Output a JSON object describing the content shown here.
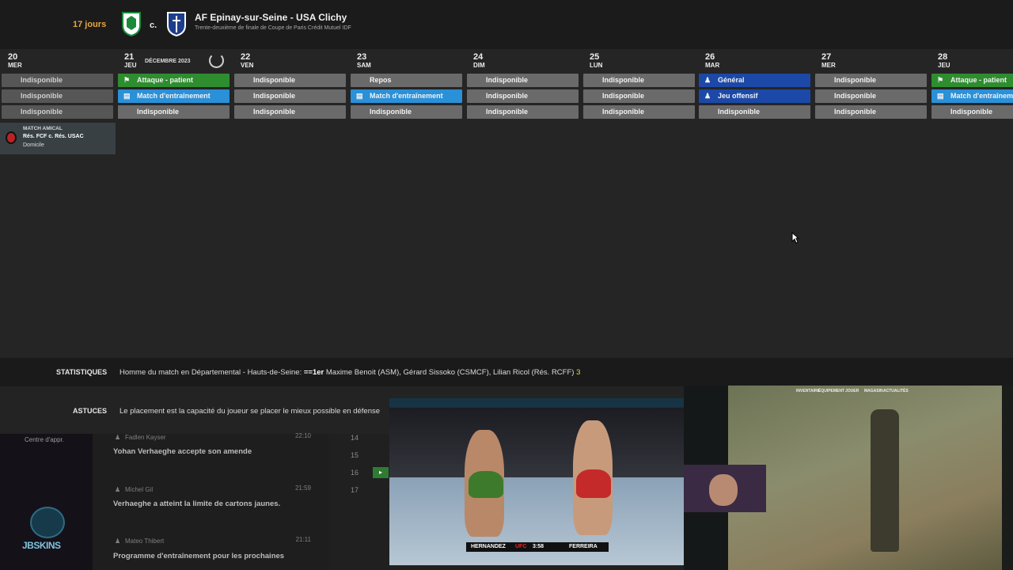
{
  "header": {
    "days_left": "17 jours",
    "vs": "c.",
    "match_title": "AF Epinay-sur-Seine - USA Clichy",
    "match_subtitle": "Trente-deuxième de finale de Coupe de Paris Crédit Mutuel IDF"
  },
  "calendar": {
    "month_label": "DÉCEMBRE 2023",
    "days": [
      {
        "num": "20",
        "name": "MER",
        "slots": [
          {
            "label": "Indisponible",
            "style": "dim"
          },
          {
            "label": "Indisponible",
            "style": "dim"
          },
          {
            "label": "Indisponible",
            "style": "dim"
          }
        ]
      },
      {
        "num": "21",
        "name": "JEU",
        "slots": [
          {
            "label": "Attaque - patient",
            "style": "green",
            "icon": "runner"
          },
          {
            "label": "Match d'entraînement",
            "style": "sky",
            "icon": "board"
          },
          {
            "label": "Indisponible",
            "style": "grey"
          }
        ]
      },
      {
        "num": "22",
        "name": "VEN",
        "slots": [
          {
            "label": "Indisponible",
            "style": "grey"
          },
          {
            "label": "Indisponible",
            "style": "grey"
          },
          {
            "label": "Indisponible",
            "style": "grey"
          }
        ]
      },
      {
        "num": "23",
        "name": "SAM",
        "slots": [
          {
            "label": "Repos",
            "style": "grey"
          },
          {
            "label": "Match d'entraînement",
            "style": "sky",
            "icon": "board"
          },
          {
            "label": "Indisponible",
            "style": "grey"
          }
        ]
      },
      {
        "num": "24",
        "name": "DIM",
        "slots": [
          {
            "label": "Indisponible",
            "style": "grey"
          },
          {
            "label": "Indisponible",
            "style": "grey"
          },
          {
            "label": "Indisponible",
            "style": "grey"
          }
        ]
      },
      {
        "num": "25",
        "name": "LUN",
        "slots": [
          {
            "label": "Indisponible",
            "style": "grey"
          },
          {
            "label": "Indisponible",
            "style": "grey"
          },
          {
            "label": "Indisponible",
            "style": "grey"
          }
        ]
      },
      {
        "num": "26",
        "name": "MAR",
        "slots": [
          {
            "label": "Général",
            "style": "navy",
            "icon": "person"
          },
          {
            "label": "Jeu offensif",
            "style": "navy",
            "icon": "person"
          },
          {
            "label": "Indisponible",
            "style": "grey"
          }
        ]
      },
      {
        "num": "27",
        "name": "MER",
        "slots": [
          {
            "label": "Indisponible",
            "style": "grey"
          },
          {
            "label": "Indisponible",
            "style": "grey"
          },
          {
            "label": "Indisponible",
            "style": "grey"
          }
        ]
      },
      {
        "num": "28",
        "name": "JEU",
        "slots": [
          {
            "label": "Attaque - patient",
            "style": "green",
            "icon": "runner"
          },
          {
            "label": "Match d'entraînement",
            "style": "sky",
            "icon": "board"
          },
          {
            "label": "Indisponible",
            "style": "grey"
          }
        ]
      }
    ]
  },
  "event": {
    "type": "MATCH AMICAL",
    "name": "Rés. FCF c. Rés. USAC",
    "location": "Domicile"
  },
  "stats": {
    "label": "STATISTIQUES",
    "prefix": "Homme du match en Départemental - Hauts-de-Seine: ",
    "rank": "==1er",
    "players": " Maxime Benoit (ASM), Gérard Sissoko (CSMCF), Lilian Ricol (Rés. RCFF) ",
    "count": "3"
  },
  "tips": {
    "label": "ASTUCES",
    "text": "Le placement est la capacité du joueur se placer le mieux possible en défense"
  },
  "sidebar": {
    "item": "Centre d'appr.",
    "logo_text": "JBSKINS"
  },
  "news": [
    {
      "author": "Fadlen Kayser",
      "time": "22:10",
      "headline": "Yohan Verhaeghe accepte son amende"
    },
    {
      "author": "Michel Gil",
      "time": "21:59",
      "headline": "Verhaeghe a atteint la limite de cartons jaunes."
    },
    {
      "author": "Mateo Thibert",
      "time": "21:11",
      "headline": "Programme d'entraînement pour les prochaines"
    }
  ],
  "rows": [
    "14",
    "15",
    "16",
    "17"
  ],
  "video": {
    "fighter_left": "HERNANDEZ",
    "brand": "UFC",
    "clock": "3:58",
    "fighter_right": "FERREIRA"
  },
  "game": {
    "nav": [
      "INVENTAIRE",
      "ÉQUIPEMENT",
      "JOUER",
      "MAGASIN",
      "ACTUALITÉS"
    ]
  },
  "colors": {
    "accent_orange": "#e8a640",
    "green": "#2e8d2f",
    "sky": "#2a90d8",
    "navy": "#1c49a8"
  }
}
